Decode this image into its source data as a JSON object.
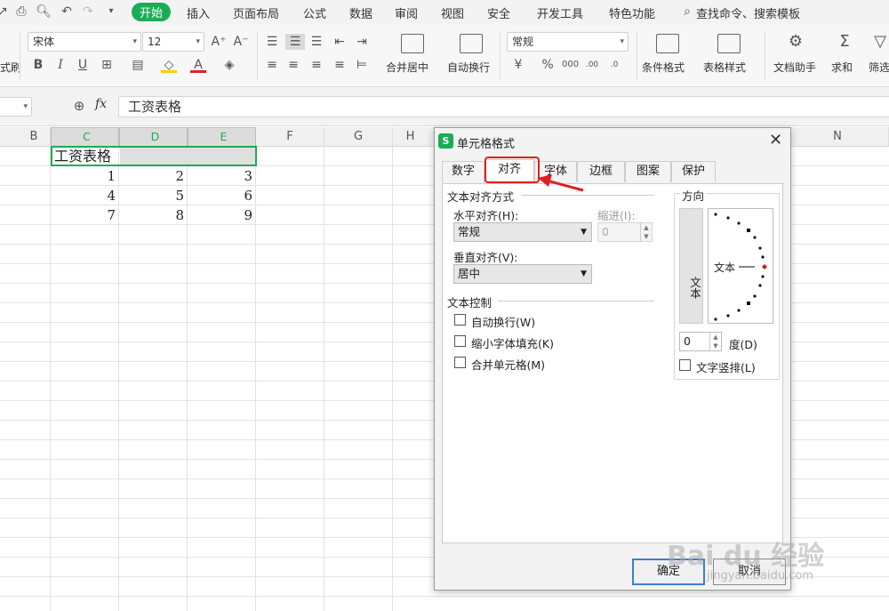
{
  "menu": {
    "tabs": [
      "开始",
      "插入",
      "页面布局",
      "公式",
      "数据",
      "审阅",
      "视图",
      "安全",
      "开发工具",
      "特色功能"
    ],
    "search": "查找命令、搜索模板"
  },
  "ribbon": {
    "left_cut_label": "式刷",
    "font_name": "宋体",
    "font_size": "12",
    "merge_label": "合并居中",
    "wrap_label": "自动换行",
    "number_format": "常规",
    "cond_format_label": "条件格式",
    "table_style_label": "表格样式",
    "doc_helper_label": "文档助手",
    "sum_label": "求和",
    "filter_label": "筛选"
  },
  "formula_bar": {
    "fx": "fx",
    "content": "工资表格"
  },
  "sheet": {
    "columns": [
      "B",
      "C",
      "D",
      "E",
      "F",
      "G",
      "H",
      "N"
    ],
    "rows": [
      {
        "c": "工资表格",
        "d": "",
        "e": ""
      },
      {
        "c": "1",
        "d": "2",
        "e": "3"
      },
      {
        "c": "4",
        "d": "5",
        "e": "6"
      },
      {
        "c": "7",
        "d": "8",
        "e": "9"
      }
    ]
  },
  "dialog": {
    "title": "单元格格式",
    "tabs": [
      "数字",
      "对齐",
      "字体",
      "边框",
      "图案",
      "保护"
    ],
    "active_tab": "对齐",
    "text_align_group": "文本对齐方式",
    "horizontal_label": "水平对齐(H):",
    "horizontal_value": "常规",
    "indent_label": "缩进(I):",
    "indent_value": "0",
    "vertical_label": "垂直对齐(V):",
    "vertical_value": "居中",
    "text_control_group": "文本控制",
    "wrap_text": "自动换行(W)",
    "shrink_to_fit": "缩小字体填充(K)",
    "merge_cells": "合并单元格(M)",
    "orientation_group": "方向",
    "vertical_text": "文本",
    "dial_text": "文本",
    "degree_value": "0",
    "degree_label": "度(D)",
    "vertical_chars": "文字竖排(L)",
    "ok": "确定",
    "cancel": "取消"
  },
  "watermark": {
    "brand": "Bai du 经验",
    "url": "jingyan.baidu.com"
  },
  "colors": {
    "accent_green": "#1aad55",
    "highlight_red": "#e02020"
  }
}
